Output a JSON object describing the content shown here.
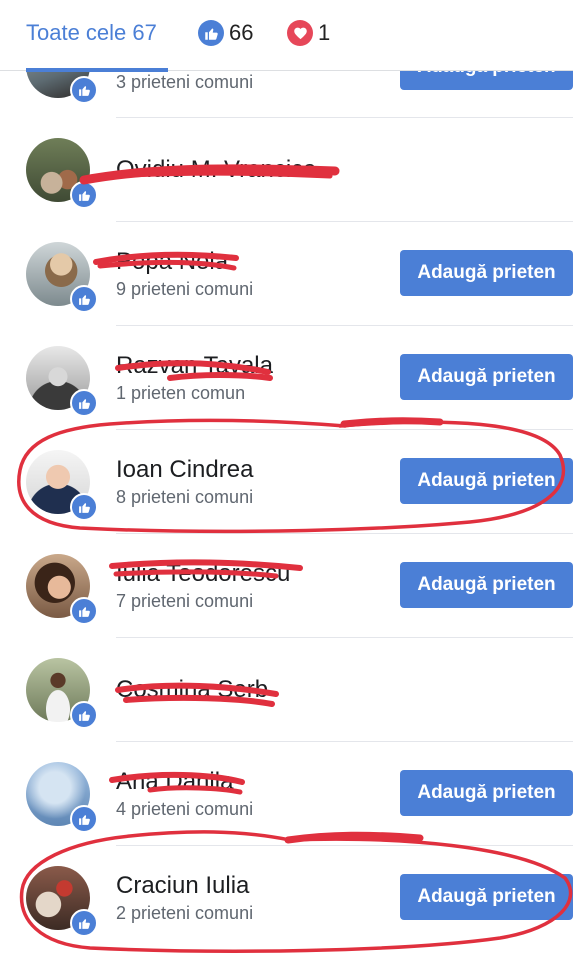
{
  "tabs": {
    "all": "Toate cele 67",
    "like_count": "66",
    "love_count": "1"
  },
  "rows": [
    {
      "name": "",
      "mutual": "3 prieteni comuni",
      "button": "Adaugă prieten"
    },
    {
      "name": "Ovidiu M. Vrancica",
      "mutual": "",
      "button": ""
    },
    {
      "name": "Popa Nela",
      "mutual": "9 prieteni comuni",
      "button": "Adaugă prieten"
    },
    {
      "name": "Razvan Tavala",
      "mutual": "1 prieten comun",
      "button": "Adaugă prieten"
    },
    {
      "name": "Ioan Cindrea",
      "mutual": "8 prieteni comuni",
      "button": "Adaugă prieten"
    },
    {
      "name": "Iulia Teodorescu",
      "mutual": "7 prieteni comuni",
      "button": "Adaugă prieten"
    },
    {
      "name": "Cosmina Serb",
      "mutual": "",
      "button": ""
    },
    {
      "name": "Ana Danila",
      "mutual": "4 prieteni comuni",
      "button": "Adaugă prieten"
    },
    {
      "name": "Craciun Iulia",
      "mutual": "2 prieteni comuni",
      "button": "Adaugă prieten"
    }
  ],
  "colors": {
    "accent": "#4b7fd6",
    "love": "#e64759",
    "annotation": "#e0303e"
  },
  "icons": {
    "like": "thumbs-up-icon",
    "love": "heart-icon"
  }
}
